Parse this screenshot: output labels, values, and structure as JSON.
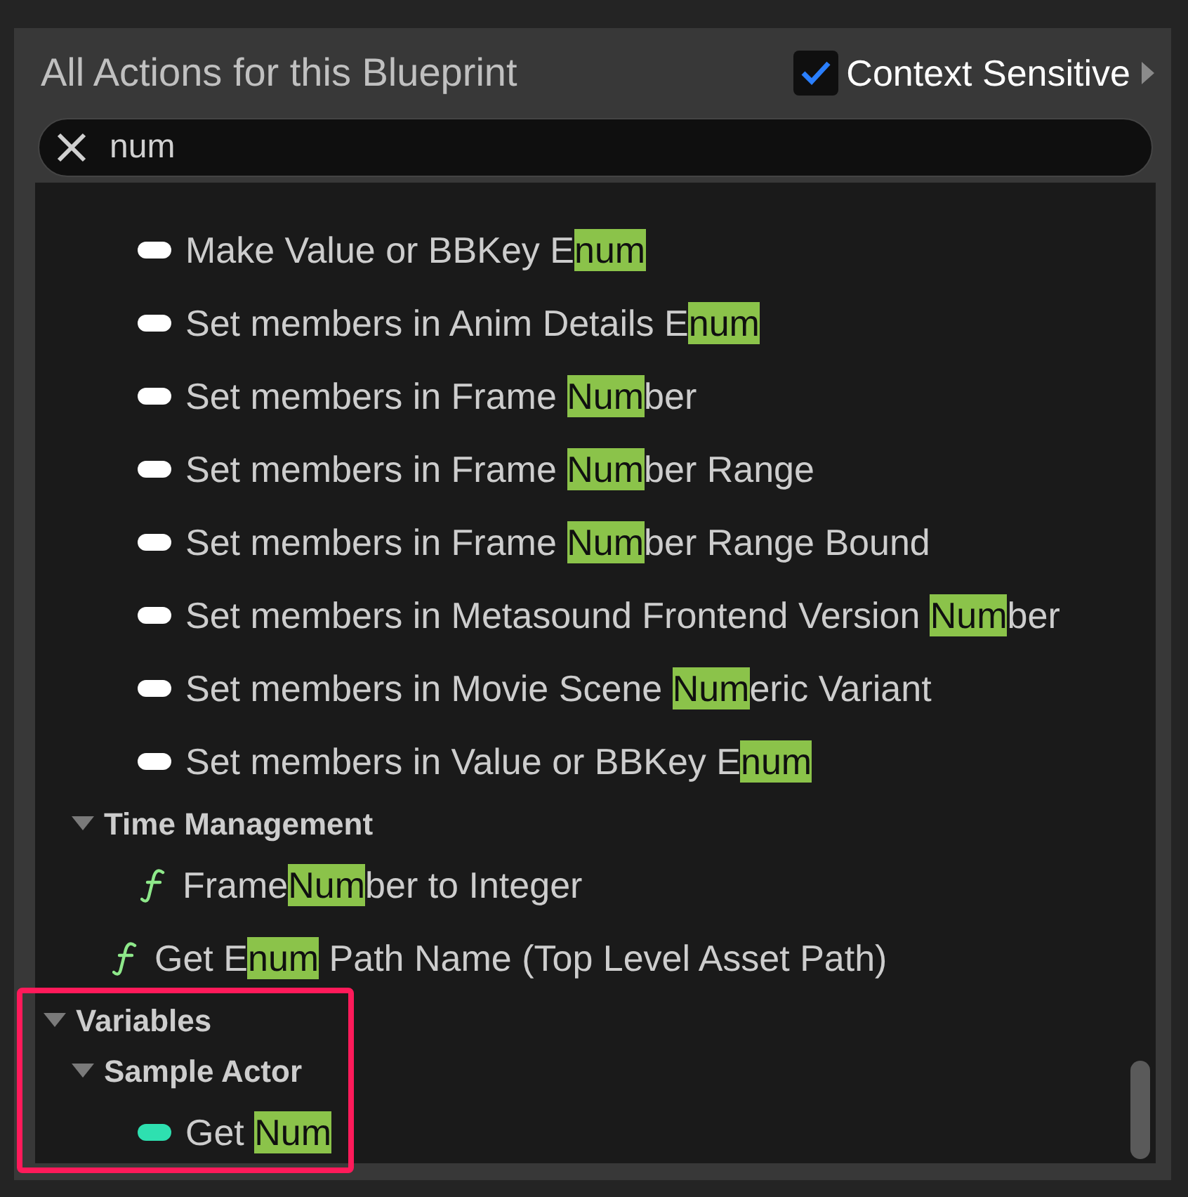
{
  "panel": {
    "title": "All Actions for this Blueprint",
    "context_sensitive": {
      "label": "Context Sensitive",
      "checked": true
    }
  },
  "search": {
    "value": "num"
  },
  "results": [
    {
      "kind": "struct",
      "parts": [
        {
          "text": "Make Value or BBKey E",
          "match": false
        },
        {
          "text": "num",
          "match": true
        }
      ]
    },
    {
      "kind": "struct",
      "parts": [
        {
          "text": "Set members in Anim Details E",
          "match": false
        },
        {
          "text": "num",
          "match": true
        }
      ]
    },
    {
      "kind": "struct",
      "parts": [
        {
          "text": "Set members in Frame ",
          "match": false
        },
        {
          "text": "Num",
          "match": true
        },
        {
          "text": "ber",
          "match": false
        }
      ]
    },
    {
      "kind": "struct",
      "parts": [
        {
          "text": "Set members in Frame ",
          "match": false
        },
        {
          "text": "Num",
          "match": true
        },
        {
          "text": "ber Range",
          "match": false
        }
      ]
    },
    {
      "kind": "struct",
      "parts": [
        {
          "text": "Set members in Frame ",
          "match": false
        },
        {
          "text": "Num",
          "match": true
        },
        {
          "text": "ber Range Bound",
          "match": false
        }
      ]
    },
    {
      "kind": "struct",
      "parts": [
        {
          "text": "Set members in Metasound Frontend Version ",
          "match": false
        },
        {
          "text": "Num",
          "match": true
        },
        {
          "text": "ber",
          "match": false
        }
      ]
    },
    {
      "kind": "struct",
      "parts": [
        {
          "text": "Set members in Movie Scene ",
          "match": false
        },
        {
          "text": "Num",
          "match": true
        },
        {
          "text": "eric Variant",
          "match": false
        }
      ]
    },
    {
      "kind": "struct",
      "parts": [
        {
          "text": "Set members in Value or BBKey E",
          "match": false
        },
        {
          "text": "num",
          "match": true
        }
      ]
    },
    {
      "kind": "category",
      "label": "Time Management",
      "expanded": true,
      "indented": true,
      "outlined": false,
      "children": [
        {
          "kind": "function",
          "parts": [
            {
              "text": "Frame",
              "match": false
            },
            {
              "text": "Num",
              "match": true
            },
            {
              "text": "ber to Integer",
              "match": false
            }
          ]
        }
      ]
    },
    {
      "kind": "function",
      "parts": [
        {
          "text": "Get E",
          "match": false
        },
        {
          "text": "num",
          "match": true
        },
        {
          "text": " Path Name (Top Level Asset Path)",
          "match": false
        }
      ]
    },
    {
      "kind": "category",
      "label": "Variables",
      "expanded": true,
      "indented": false,
      "outlined": true,
      "children": [
        {
          "kind": "category",
          "label": "Sample Actor",
          "expanded": true,
          "indented": true,
          "children": [
            {
              "kind": "variable",
              "parts": [
                {
                  "text": "Get ",
                  "match": false
                },
                {
                  "text": "Num",
                  "match": true
                }
              ]
            }
          ]
        }
      ]
    }
  ]
}
